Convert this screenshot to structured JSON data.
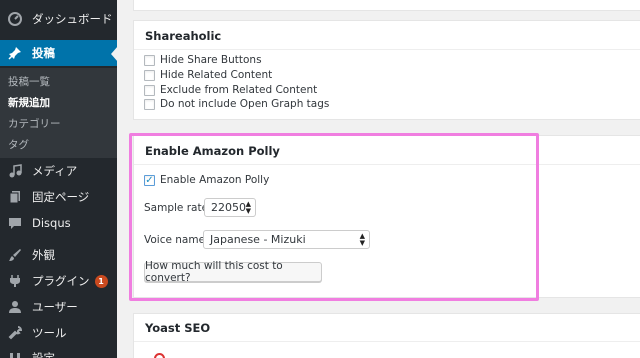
{
  "sidebar": {
    "dashboard": "ダッシュボード",
    "posts": "投稿",
    "submenu": [
      "投稿一覧",
      "新規追加",
      "カテゴリー",
      "タグ"
    ],
    "media": "メディア",
    "pages": "固定ページ",
    "disqus": "Disqus",
    "appearance": "外観",
    "plugins": "プラグイン",
    "plugins_badge": "1",
    "users": "ユーザー",
    "tools": "ツール",
    "settings": "設定"
  },
  "shareaholic": {
    "title": "Shareaholic",
    "options": [
      "Hide Share Buttons",
      "Hide Related Content",
      "Exclude from Related Content",
      "Do not include Open Graph tags"
    ]
  },
  "polly": {
    "title": "Enable Amazon Polly",
    "enable_label": "Enable Amazon Polly",
    "sample_rate_label": "Sample rate:",
    "sample_rate_value": "22050",
    "voice_name_label": "Voice name:",
    "voice_name_value": "Japanese - Mizuki",
    "cost_button": "How much will this cost to convert?"
  },
  "yoast": {
    "title": "Yoast SEO"
  },
  "colors": {
    "sidebar_bg": "#23282d",
    "active_menu": "#0073aa",
    "highlight_border": "#f07ee0",
    "badge": "#ca4a1f"
  }
}
